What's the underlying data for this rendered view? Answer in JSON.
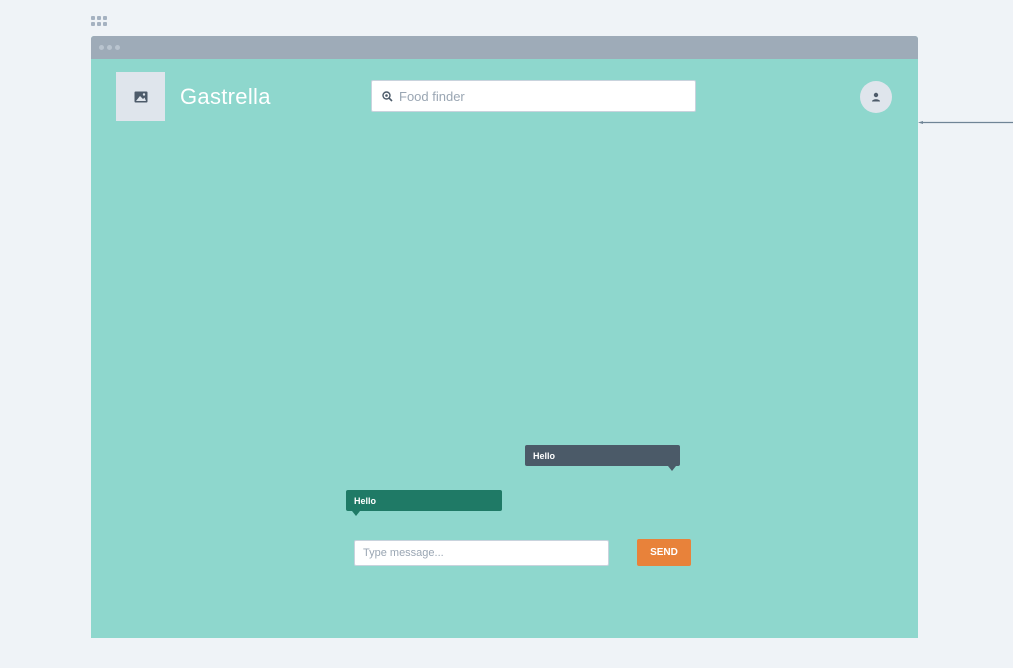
{
  "app": {
    "name": "Gastrella"
  },
  "header": {
    "search_placeholder": "Food finder",
    "search_icon": "search-icon",
    "logo_icon": "image-icon",
    "avatar_icon": "user-icon"
  },
  "chat": {
    "messages": [
      {
        "text": "Hello",
        "side": "right",
        "color": "#4b5a68"
      },
      {
        "text": "Hello",
        "side": "left",
        "color": "#1f7a66"
      }
    ],
    "input_placeholder": "Type message...",
    "send_label": "SEND"
  },
  "colors": {
    "background": "#8ed7cd",
    "accent": "#e8823a",
    "titlebar": "#9eabb8"
  }
}
